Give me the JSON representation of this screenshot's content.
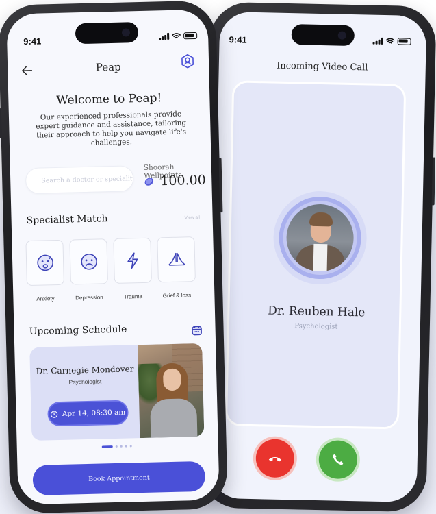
{
  "left_phone": {
    "status": {
      "time": "9:41"
    },
    "header": {
      "title": "Peap",
      "back_icon": "arrow-left-icon",
      "profile_icon": "user-profile-icon"
    },
    "welcome": {
      "title": "Welcome to Peap!",
      "text": "Our experienced professionals provide expert guidance and assistance, tailoring their approach to help you navigate life's challenges."
    },
    "search": {
      "placeholder": "Search a doctor or speciality"
    },
    "wellpoints": {
      "label": "Shoorah Wellpoints",
      "value": "100.00",
      "icon": "coin-icon"
    },
    "specialist_match": {
      "title": "Specialist  Match",
      "view_all": "View all",
      "categories": [
        {
          "label": "Anxiety",
          "icon": "anxious-face-icon"
        },
        {
          "label": "Depression",
          "icon": "sad-face-icon"
        },
        {
          "label": "Trauma",
          "icon": "lightning-icon"
        },
        {
          "label": "Grief & loss",
          "icon": "praying-hands-icon"
        }
      ]
    },
    "upcoming": {
      "title": "Upcoming Schedule",
      "icon": "calendar-icon",
      "card": {
        "doctor_name": "Dr. Carnegie Mondover",
        "role": "Psychologist",
        "appointment": "Apr 14, 08:30 am",
        "time_icon": "clock-icon"
      },
      "pagination": {
        "count": 5,
        "active": 0
      }
    },
    "cta": {
      "label": "Book Appointment"
    },
    "accent": "#4a50d8"
  },
  "right_phone": {
    "status": {
      "time": "9:41"
    },
    "title": "Incoming Video Call",
    "caller": {
      "name": "Dr. Reuben Hale",
      "role": "Psychologist"
    },
    "actions": {
      "decline_icon": "phone-hangup-icon",
      "accept_icon": "phone-icon"
    },
    "colors": {
      "decline": "#e9342e",
      "accept": "#4cac43"
    }
  }
}
